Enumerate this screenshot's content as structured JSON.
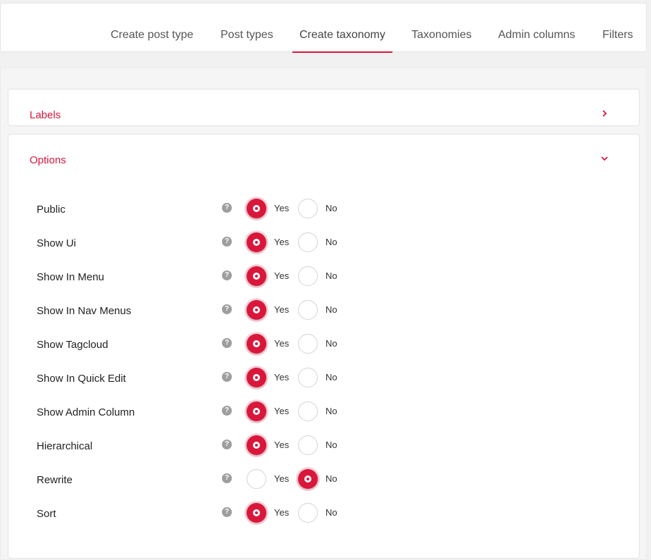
{
  "tabs": [
    {
      "label": "Create post type",
      "active": false
    },
    {
      "label": "Post types",
      "active": false
    },
    {
      "label": "Create taxonomy",
      "active": true
    },
    {
      "label": "Taxonomies",
      "active": false
    },
    {
      "label": "Admin columns",
      "active": false
    },
    {
      "label": "Filters",
      "active": false
    }
  ],
  "labels_section": {
    "title": "Labels",
    "icon": "chevron-right-icon"
  },
  "options_section": {
    "title": "Options",
    "icon": "chevron-down-icon"
  },
  "radio_labels": {
    "yes": "Yes",
    "no": "No"
  },
  "help_glyph": "?",
  "options": [
    {
      "label": "Public",
      "value": "yes"
    },
    {
      "label": "Show Ui",
      "value": "yes"
    },
    {
      "label": "Show In Menu",
      "value": "yes"
    },
    {
      "label": "Show In Nav Menus",
      "value": "yes"
    },
    {
      "label": "Show Tagcloud",
      "value": "yes"
    },
    {
      "label": "Show In Quick Edit",
      "value": "yes"
    },
    {
      "label": "Show Admin Column",
      "value": "yes"
    },
    {
      "label": "Hierarchical",
      "value": "yes"
    },
    {
      "label": "Rewrite",
      "value": "no"
    },
    {
      "label": "Sort",
      "value": "yes"
    }
  ],
  "accent_color": "#d9173b"
}
